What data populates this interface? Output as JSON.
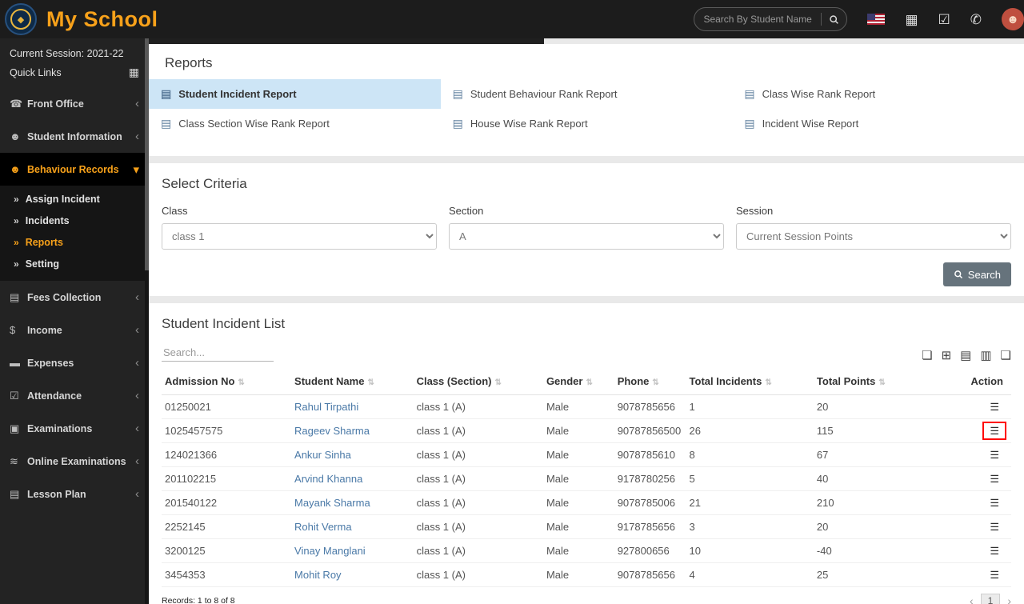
{
  "topbar": {
    "app_title": "My School",
    "search_placeholder": "Search By Student Name",
    "icons": [
      "flag-icon",
      "calendar-icon",
      "task-icon",
      "chat-icon",
      "avatar-icon"
    ]
  },
  "sidebar": {
    "session_label": "Current Session: 2021-22",
    "quick_links_label": "Quick Links",
    "menu": [
      {
        "label": "Front Office",
        "icon": "headset-icon",
        "expanded": false
      },
      {
        "label": "Student Information",
        "icon": "user-icon",
        "expanded": false
      },
      {
        "label": "Behaviour Records",
        "icon": "user-plus-icon",
        "expanded": true,
        "active": true,
        "children": [
          {
            "label": "Assign Incident",
            "active": false
          },
          {
            "label": "Incidents",
            "active": false
          },
          {
            "label": "Reports",
            "active": true
          },
          {
            "label": "Setting",
            "active": false
          }
        ]
      },
      {
        "label": "Fees Collection",
        "icon": "money-icon",
        "expanded": false
      },
      {
        "label": "Income",
        "icon": "dollar-icon",
        "expanded": false
      },
      {
        "label": "Expenses",
        "icon": "wallet-icon",
        "expanded": false
      },
      {
        "label": "Attendance",
        "icon": "calendar-check-icon",
        "expanded": false
      },
      {
        "label": "Examinations",
        "icon": "book-icon",
        "expanded": false
      },
      {
        "label": "Online Examinations",
        "icon": "signal-icon",
        "expanded": false
      },
      {
        "label": "Lesson Plan",
        "icon": "lesson-icon",
        "expanded": false
      }
    ]
  },
  "reports": {
    "title": "Reports",
    "links": [
      {
        "label": "Student Incident Report",
        "active": true
      },
      {
        "label": "Student Behaviour Rank Report",
        "active": false
      },
      {
        "label": "Class Wise Rank Report",
        "active": false
      },
      {
        "label": "Class Section Wise Rank Report",
        "active": false
      },
      {
        "label": "House Wise Rank Report",
        "active": false
      },
      {
        "label": "Incident Wise Report",
        "active": false
      }
    ]
  },
  "criteria": {
    "title": "Select Criteria",
    "fields": [
      {
        "label": "Class",
        "value": "class 1"
      },
      {
        "label": "Section",
        "value": "A"
      },
      {
        "label": "Session",
        "value": "Current Session Points"
      }
    ],
    "search_button": "Search"
  },
  "incident_list": {
    "title": "Student Incident List",
    "search_placeholder": "Search...",
    "export_icons": [
      "copy-icon",
      "excel-icon",
      "csv-icon",
      "pdf-icon",
      "print-icon"
    ],
    "columns": [
      "Admission No",
      "Student Name",
      "Class (Section)",
      "Gender",
      "Phone",
      "Total Incidents",
      "Total Points",
      "Action"
    ],
    "rows": [
      [
        "01250021",
        "Rahul Tirpathi",
        "class 1 (A)",
        "Male",
        "9078785656",
        "1",
        "20"
      ],
      [
        "1025457575",
        "Rageev Sharma",
        "class 1 (A)",
        "Male",
        "90787856500",
        "26",
        "115"
      ],
      [
        "124021366",
        "Ankur Sinha",
        "class 1 (A)",
        "Male",
        "9078785610",
        "8",
        "67"
      ],
      [
        "201102215",
        "Arvind Khanna",
        "class 1 (A)",
        "Male",
        "9178780256",
        "5",
        "40"
      ],
      [
        "201540122",
        "Mayank Sharma",
        "class 1 (A)",
        "Male",
        "9078785006",
        "21",
        "210"
      ],
      [
        "2252145",
        "Rohit Verma",
        "class 1 (A)",
        "Male",
        "9178785656",
        "3",
        "20"
      ],
      [
        "3200125",
        "Vinay Manglani",
        "class 1 (A)",
        "Male",
        "927800656",
        "10",
        "-40"
      ],
      [
        "3454353",
        "Mohit Roy",
        "class 1 (A)",
        "Male",
        "9078785656",
        "4",
        "25"
      ]
    ],
    "highlighted_row_index": 1,
    "records_text": "Records: 1 to 8 of 8",
    "pagination": {
      "prev": "‹",
      "current": "1",
      "next": "›"
    }
  },
  "colors": {
    "accent_orange": "#f7a11a",
    "link_blue": "#4a79a7",
    "active_report_bg": "#cde5f6",
    "highlight_red": "#ff0000"
  }
}
